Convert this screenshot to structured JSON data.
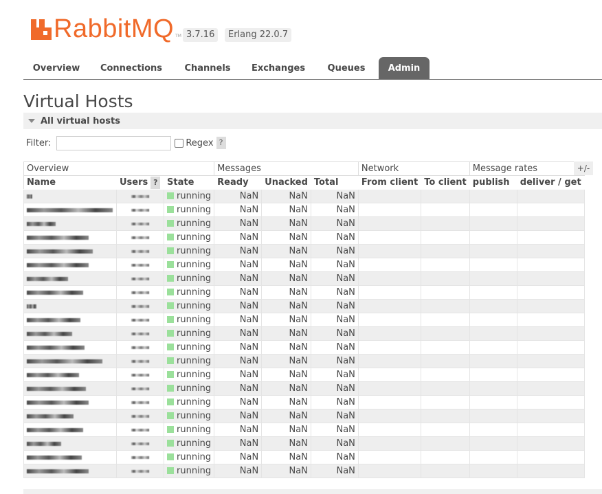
{
  "header": {
    "brand": "RabbitMQ",
    "trademark": "TM",
    "version": "3.7.16",
    "erlang": "Erlang 22.0.7"
  },
  "tabs": [
    {
      "label": "Overview",
      "active": false
    },
    {
      "label": "Connections",
      "active": false
    },
    {
      "label": "Channels",
      "active": false
    },
    {
      "label": "Exchanges",
      "active": false
    },
    {
      "label": "Queues",
      "active": false
    },
    {
      "label": "Admin",
      "active": true
    }
  ],
  "page": {
    "title": "Virtual Hosts",
    "section": "All virtual hosts"
  },
  "filter": {
    "label": "Filter:",
    "value": "",
    "regex_label": "Regex",
    "regex_checked": false,
    "help": "?"
  },
  "table": {
    "groups": [
      "Overview",
      "Messages",
      "Network",
      "Message rates"
    ],
    "columns": [
      "Name",
      "Users",
      "State",
      "Ready",
      "Unacked",
      "Total",
      "From client",
      "To client",
      "publish",
      "deliver / get"
    ],
    "users_help": "?",
    "toggle_columns": "+/-",
    "rows": [
      {
        "state": "running",
        "ready": "NaN",
        "unacked": "NaN",
        "total": "NaN"
      },
      {
        "state": "running",
        "ready": "NaN",
        "unacked": "NaN",
        "total": "NaN"
      },
      {
        "state": "running",
        "ready": "NaN",
        "unacked": "NaN",
        "total": "NaN"
      },
      {
        "state": "running",
        "ready": "NaN",
        "unacked": "NaN",
        "total": "NaN"
      },
      {
        "state": "running",
        "ready": "NaN",
        "unacked": "NaN",
        "total": "NaN"
      },
      {
        "state": "running",
        "ready": "NaN",
        "unacked": "NaN",
        "total": "NaN"
      },
      {
        "state": "running",
        "ready": "NaN",
        "unacked": "NaN",
        "total": "NaN"
      },
      {
        "state": "running",
        "ready": "NaN",
        "unacked": "NaN",
        "total": "NaN"
      },
      {
        "state": "running",
        "ready": "NaN",
        "unacked": "NaN",
        "total": "NaN"
      },
      {
        "state": "running",
        "ready": "NaN",
        "unacked": "NaN",
        "total": "NaN"
      },
      {
        "state": "running",
        "ready": "NaN",
        "unacked": "NaN",
        "total": "NaN"
      },
      {
        "state": "running",
        "ready": "NaN",
        "unacked": "NaN",
        "total": "NaN"
      },
      {
        "state": "running",
        "ready": "NaN",
        "unacked": "NaN",
        "total": "NaN"
      },
      {
        "state": "running",
        "ready": "NaN",
        "unacked": "NaN",
        "total": "NaN"
      },
      {
        "state": "running",
        "ready": "NaN",
        "unacked": "NaN",
        "total": "NaN"
      },
      {
        "state": "running",
        "ready": "NaN",
        "unacked": "NaN",
        "total": "NaN"
      },
      {
        "state": "running",
        "ready": "NaN",
        "unacked": "NaN",
        "total": "NaN"
      },
      {
        "state": "running",
        "ready": "NaN",
        "unacked": "NaN",
        "total": "NaN"
      },
      {
        "state": "running",
        "ready": "NaN",
        "unacked": "NaN",
        "total": "NaN"
      },
      {
        "state": "running",
        "ready": "NaN",
        "unacked": "NaN",
        "total": "NaN"
      },
      {
        "state": "running",
        "ready": "NaN",
        "unacked": "NaN",
        "total": "NaN"
      }
    ]
  },
  "colors": {
    "brand_orange": "#f06a2a",
    "tab_active_bg": "#666666",
    "running_indicator": "#9be09b",
    "row_alt": "#eeeeee"
  }
}
